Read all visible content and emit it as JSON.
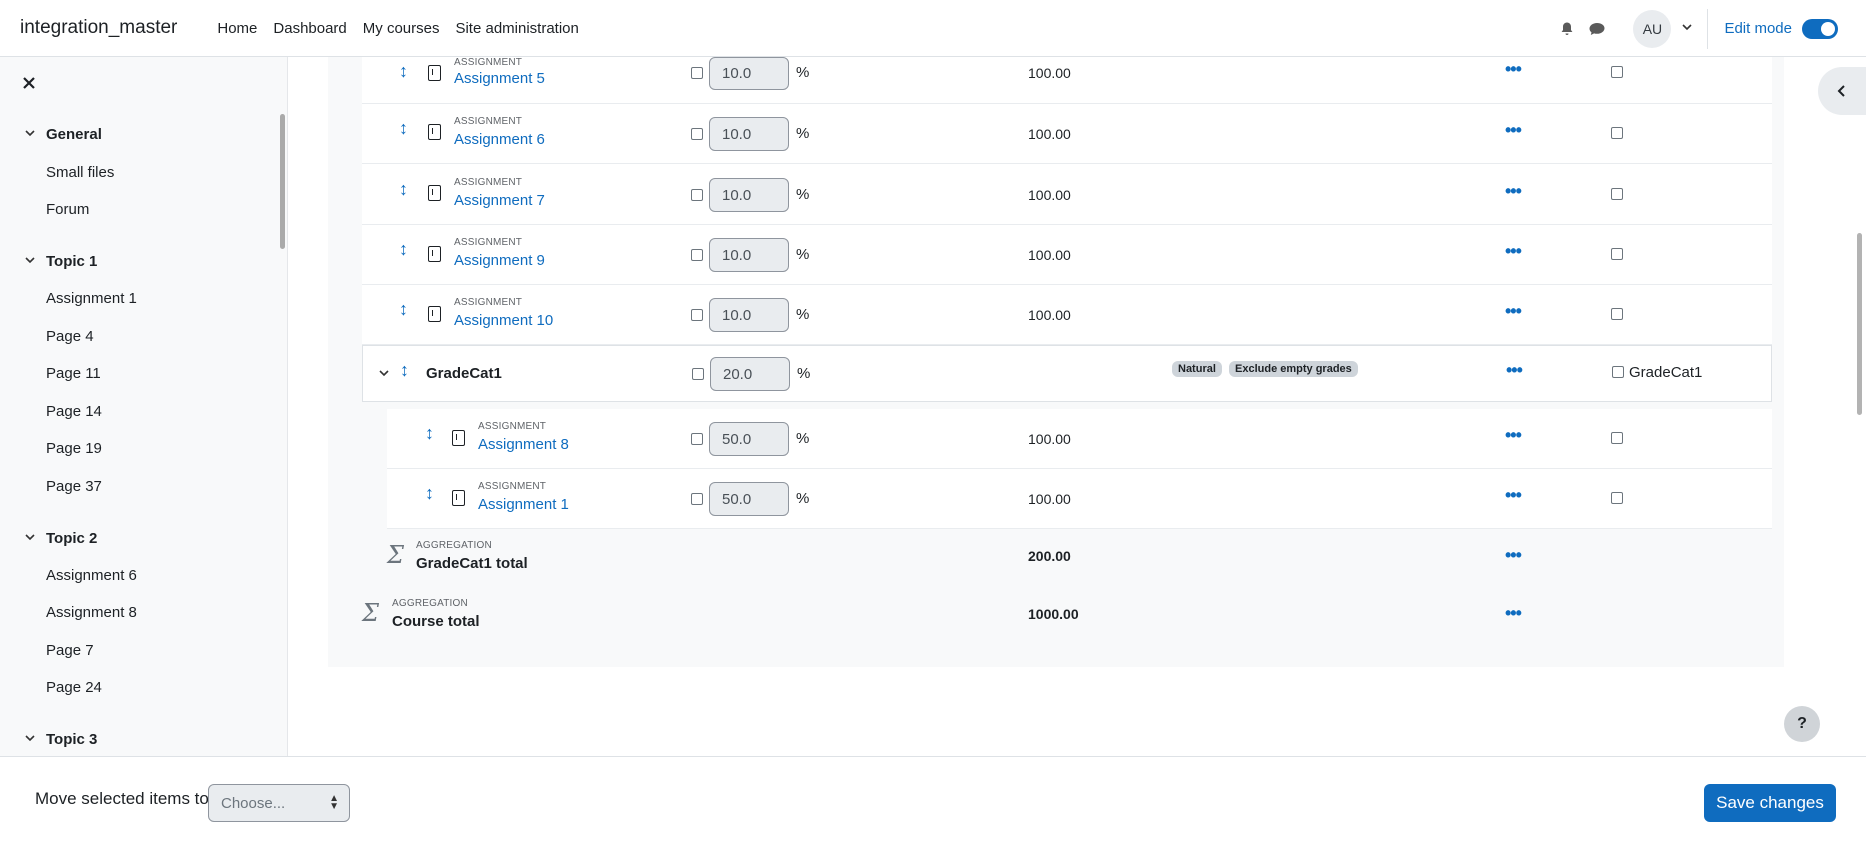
{
  "navbar": {
    "site_name": "integration_master",
    "links": [
      "Home",
      "Dashboard",
      "My courses",
      "Site administration"
    ],
    "avatar_initials": "AU",
    "edit_mode_label": "Edit mode"
  },
  "drawer": {
    "sections": [
      {
        "title": "General",
        "items": [
          "Small files",
          "Forum"
        ]
      },
      {
        "title": "Topic 1",
        "items": [
          "Assignment 1",
          "Page 4",
          "Page 11",
          "Page 14",
          "Page 19",
          "Page 37"
        ]
      },
      {
        "title": "Topic 2",
        "items": [
          "Assignment 6",
          "Assignment 8",
          "Page 7",
          "Page 24"
        ]
      },
      {
        "title": "Topic 3",
        "items": []
      }
    ]
  },
  "gradebook": {
    "items": [
      {
        "type": "ASSIGNMENT",
        "name": "Assignment 5",
        "weight": "10.0",
        "max": "100.00"
      },
      {
        "type": "ASSIGNMENT",
        "name": "Assignment 6",
        "weight": "10.0",
        "max": "100.00"
      },
      {
        "type": "ASSIGNMENT",
        "name": "Assignment 7",
        "weight": "10.0",
        "max": "100.00"
      },
      {
        "type": "ASSIGNMENT",
        "name": "Assignment 9",
        "weight": "10.0",
        "max": "100.00"
      },
      {
        "type": "ASSIGNMENT",
        "name": "Assignment 10",
        "weight": "10.0",
        "max": "100.00"
      }
    ],
    "category": {
      "name": "GradeCat1",
      "weight": "20.0",
      "badges": [
        "Natural",
        "Exclude empty grades"
      ],
      "select_label": "GradeCat1",
      "items": [
        {
          "type": "ASSIGNMENT",
          "name": "Assignment 8",
          "weight": "50.0",
          "max": "100.00"
        },
        {
          "type": "ASSIGNMENT",
          "name": "Assignment 1",
          "weight": "50.0",
          "max": "100.00"
        }
      ],
      "total": {
        "type": "AGGREGATION",
        "name": "GradeCat1 total",
        "max": "200.00"
      }
    },
    "course_total": {
      "type": "AGGREGATION",
      "name": "Course total",
      "max": "1000.00"
    },
    "percent_sign": "%"
  },
  "footer": {
    "move_label": "Move selected items to",
    "select_placeholder": "Choose...",
    "save_label": "Save changes"
  },
  "help_label": "?"
}
